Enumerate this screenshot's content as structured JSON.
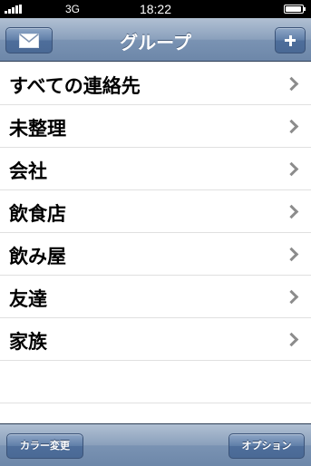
{
  "status_bar": {
    "carrier": "3G",
    "time": "18:22"
  },
  "nav_bar": {
    "title": "グループ"
  },
  "groups": [
    {
      "label": "すべての連絡先"
    },
    {
      "label": "未整理"
    },
    {
      "label": "会社"
    },
    {
      "label": "飲食店"
    },
    {
      "label": "飲み屋"
    },
    {
      "label": "友達"
    },
    {
      "label": "家族"
    }
  ],
  "toolbar": {
    "color_change_label": "カラー変更",
    "options_label": "オプション"
  },
  "icons": {
    "mail": "envelope-icon",
    "add": "plus-icon",
    "disclosure": "chevron-right-icon"
  },
  "colors": {
    "nav_bar": "#7a93b3",
    "separator": "#e0e0e0",
    "chevron": "#8c8c8c"
  }
}
